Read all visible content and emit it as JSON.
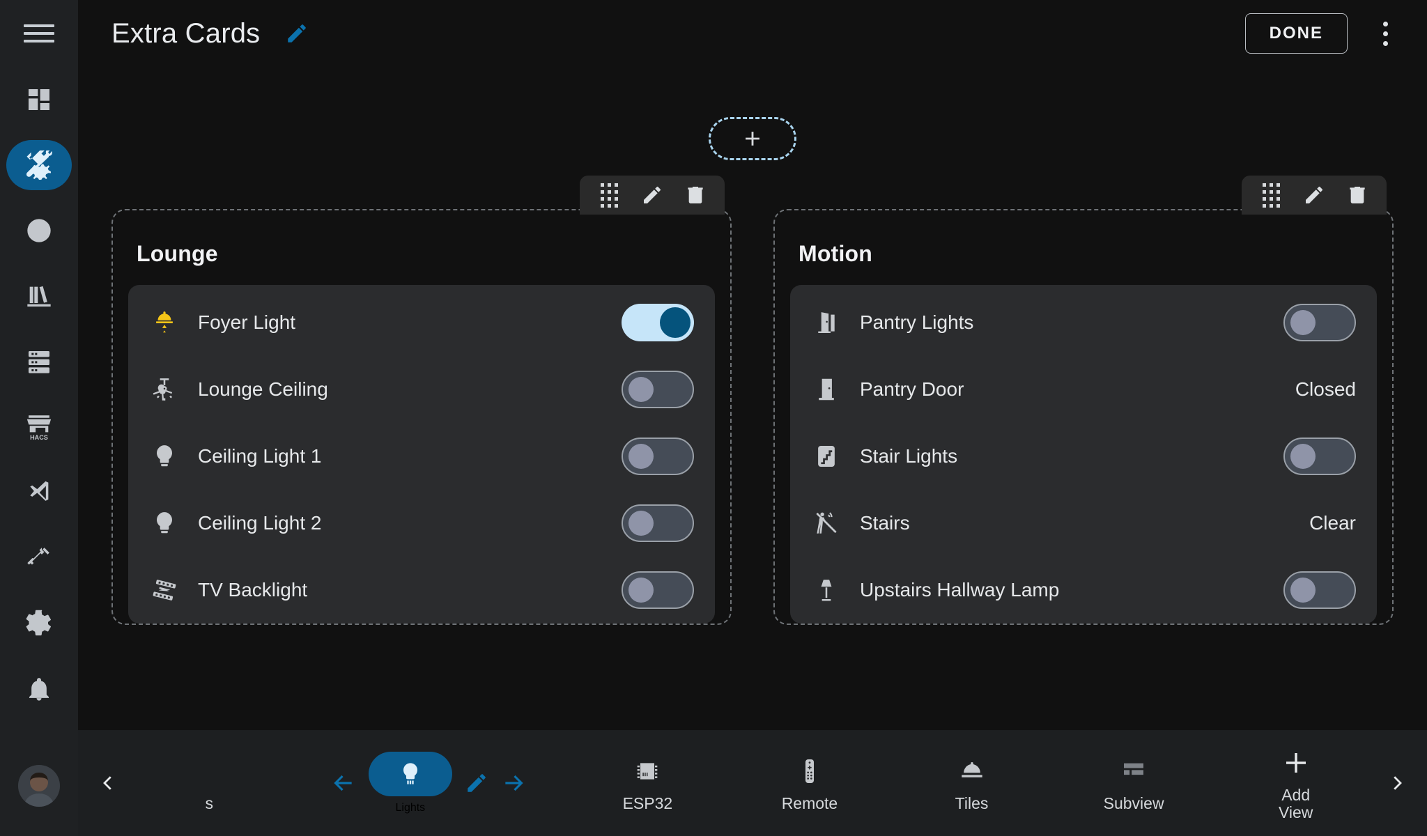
{
  "header": {
    "title": "Extra Cards",
    "edit_icon": "pencil-icon",
    "done_label": "DONE",
    "overflow_icon": "more-vertical-icon"
  },
  "sidebar": {
    "menu_icon": "hamburger-menu-icon",
    "items": [
      {
        "name": "dashboard",
        "icon": "view-dashboard-icon",
        "active": false
      },
      {
        "name": "tools",
        "icon": "tools-icon",
        "active": true
      },
      {
        "name": "history",
        "icon": "clock-icon",
        "active": false
      },
      {
        "name": "logbook",
        "icon": "bookshelf-icon",
        "active": false
      },
      {
        "name": "developer-tools",
        "icon": "server-icon",
        "active": false
      },
      {
        "name": "hacs",
        "icon": "hacs-storefront-icon",
        "active": false
      },
      {
        "name": "vscode",
        "icon": "vscode-icon",
        "active": false
      },
      {
        "name": "terminal",
        "icon": "hammer-icon",
        "active": false
      },
      {
        "name": "settings",
        "icon": "gear-icon",
        "active": false
      },
      {
        "name": "notifications",
        "icon": "bell-icon",
        "active": false
      }
    ],
    "avatar": "user-avatar"
  },
  "add_card": {
    "icon": "plus-icon"
  },
  "card_toolbar": {
    "drag_icon": "drag-handle-icon",
    "edit_icon": "pencil-icon",
    "delete_icon": "trash-icon"
  },
  "cards": [
    {
      "title": "Lounge",
      "entities": [
        {
          "name": "Foyer Light",
          "icon": "ceiling-light-on-icon",
          "icon_color": "#f5c518",
          "control": "toggle",
          "state": "on"
        },
        {
          "name": "Lounge Ceiling",
          "icon": "ceiling-fan-light-icon",
          "icon_color": "#c6c9cd",
          "control": "toggle",
          "state": "off"
        },
        {
          "name": "Ceiling Light 1",
          "icon": "lightbulb-icon",
          "icon_color": "#c6c9cd",
          "control": "toggle",
          "state": "off"
        },
        {
          "name": "Ceiling Light 2",
          "icon": "lightbulb-icon",
          "icon_color": "#c6c9cd",
          "control": "toggle",
          "state": "off"
        },
        {
          "name": "TV Backlight",
          "icon": "led-strip-icon",
          "icon_color": "#c6c9cd",
          "control": "toggle",
          "state": "off"
        }
      ]
    },
    {
      "title": "Motion",
      "entities": [
        {
          "name": "Pantry Lights",
          "icon": "door-open-icon",
          "icon_color": "#c6c9cd",
          "control": "toggle",
          "state": "off"
        },
        {
          "name": "Pantry Door",
          "icon": "door-closed-icon",
          "icon_color": "#c6c9cd",
          "control": "text",
          "state": "Closed"
        },
        {
          "name": "Stair Lights",
          "icon": "stairs-icon",
          "icon_color": "#c6c9cd",
          "control": "toggle",
          "state": "off"
        },
        {
          "name": "Stairs",
          "icon": "motion-sensor-off-icon",
          "icon_color": "#c6c9cd",
          "control": "text",
          "state": "Clear"
        },
        {
          "name": "Upstairs Hallway Lamp",
          "icon": "floor-lamp-icon",
          "icon_color": "#c6c9cd",
          "control": "toggle",
          "state": "off"
        }
      ]
    }
  ],
  "bottom_nav": {
    "scroll_left_icon": "chevron-left-icon",
    "scroll_right_icon": "chevron-right-icon",
    "move_left_icon": "arrow-left-icon",
    "move_right_icon": "arrow-right-icon",
    "edit_view_icon": "pencil-icon",
    "views": [
      {
        "label": "s",
        "icon": "clipped-view-icon",
        "active": false
      },
      {
        "label": "Lights",
        "icon": "lightbulb-group-icon",
        "active": true
      },
      {
        "label": "ESP32",
        "icon": "chip-icon",
        "active": false
      },
      {
        "label": "Remote",
        "icon": "remote-icon",
        "active": false
      },
      {
        "label": "Tiles",
        "icon": "dome-icon",
        "active": false
      },
      {
        "label": "Subview",
        "icon": "view-quilt-icon",
        "active": false
      }
    ],
    "add_view": {
      "label_line1": "Add",
      "label_line2": "View",
      "icon": "plus-icon"
    }
  },
  "colors": {
    "accent": "#0b5d90",
    "accent_light": "#c6e5f9",
    "on_icon": "#f5c518",
    "background": "#111111",
    "sidebar_bg": "#1f2123",
    "card_bg": "#2b2c2e"
  }
}
